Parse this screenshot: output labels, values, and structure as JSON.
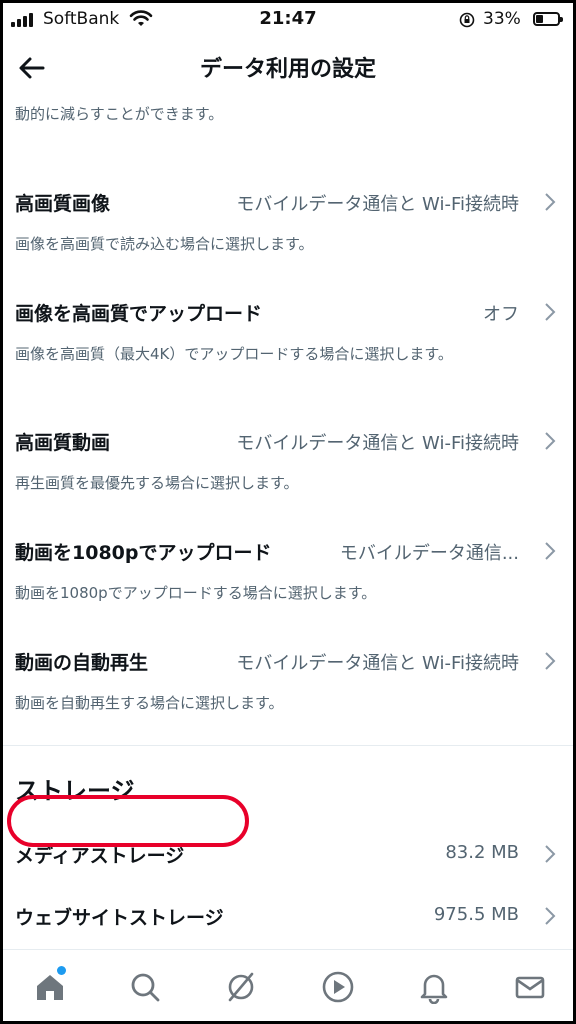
{
  "status_bar": {
    "carrier": "SoftBank",
    "time": "21:47",
    "battery_percent": "33%",
    "battery_level": 0.33
  },
  "header": {
    "title": "データ利用の設定",
    "back_icon": "arrow-left-icon"
  },
  "intro_text": "動的に減らすことができます。",
  "settings": [
    {
      "label": "高画質画像",
      "value": "モバイルデータ通信と Wi-Fi接続時",
      "description": "画像を高画質で読み込む場合に選択します。"
    },
    {
      "label": "画像を高画質でアップロード",
      "value": "オフ",
      "description": "画像を高画質（最大4K）でアップロードする場合に選択します。"
    },
    {
      "label": "高画質動画",
      "value": "モバイルデータ通信と Wi-Fi接続時",
      "description": "再生画質を最優先する場合に選択します。"
    },
    {
      "label": "動画を1080pでアップロード",
      "value": "モバイルデータ通信...",
      "description": "動画を1080pでアップロードする場合に選択します。"
    },
    {
      "label": "動画の自動再生",
      "value": "モバイルデータ通信と Wi-Fi接続時",
      "description": "動画を自動再生する場合に選択します。"
    }
  ],
  "storage": {
    "title": "ストレージ",
    "items": [
      {
        "label": "メディアストレージ",
        "value": "83.2 MB"
      },
      {
        "label": "ウェブサイトストレージ",
        "value": "975.5 MB"
      }
    ]
  },
  "colors": {
    "highlight": "#e8002a",
    "accent": "#1d9bf0",
    "secondary_text": "#536471"
  },
  "tabbar": {
    "icons": [
      "home-icon",
      "search-icon",
      "spaces-icon",
      "video-play-icon",
      "bell-icon",
      "mail-icon"
    ]
  }
}
